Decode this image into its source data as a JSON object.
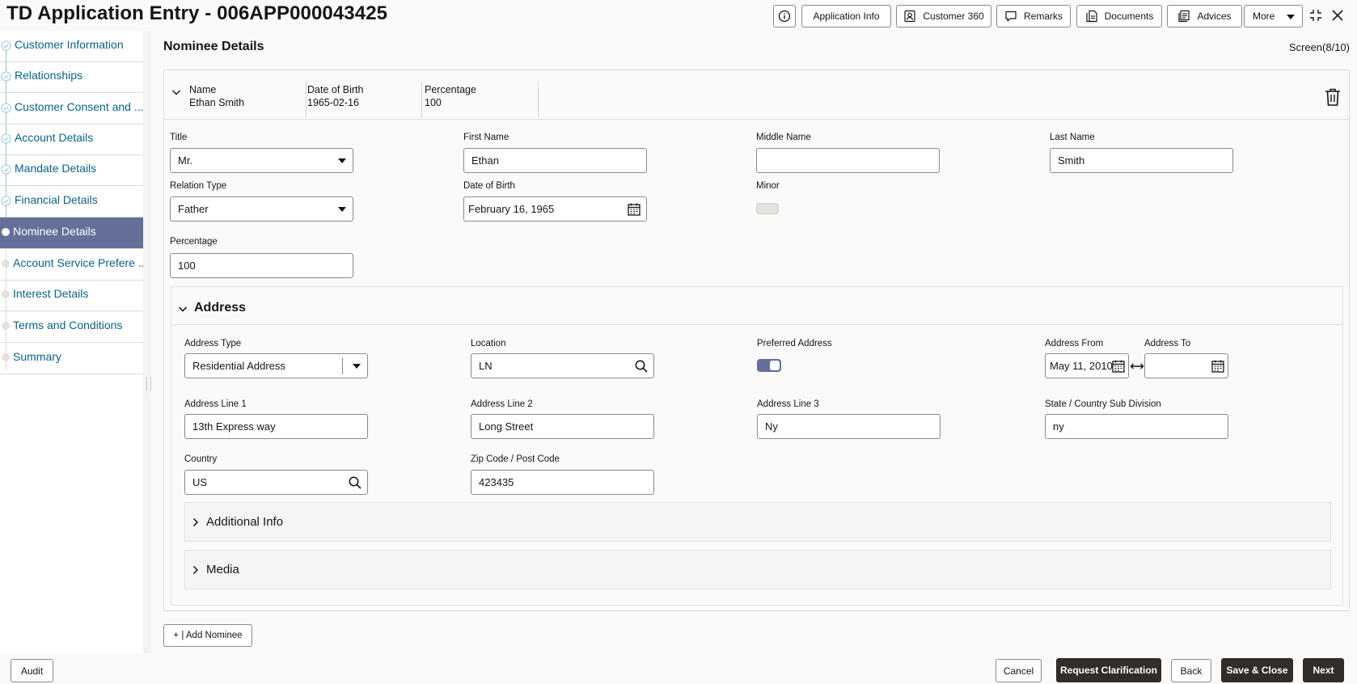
{
  "header": {
    "title": "TD Application Entry - 006APP000043425",
    "buttons": {
      "application_info": "Application Info",
      "customer_360": "Customer 360",
      "remarks": "Remarks",
      "documents": "Documents",
      "advices": "Advices",
      "more": "More"
    }
  },
  "sidebar": {
    "items": [
      {
        "label": "Customer Information",
        "state": "completed"
      },
      {
        "label": "Relationships",
        "state": "completed"
      },
      {
        "label": "Customer Consent and ...",
        "state": "completed"
      },
      {
        "label": "Account Details",
        "state": "completed"
      },
      {
        "label": "Mandate Details",
        "state": "completed"
      },
      {
        "label": "Financial Details",
        "state": "completed"
      },
      {
        "label": "Nominee Details",
        "state": "active"
      },
      {
        "label": "Account Service Prefere ...",
        "state": "pending"
      },
      {
        "label": "Interest Details",
        "state": "pending"
      },
      {
        "label": "Terms and Conditions",
        "state": "pending"
      },
      {
        "label": "Summary",
        "state": "pending"
      }
    ]
  },
  "main": {
    "section_title": "Nominee Details",
    "screen": "Screen(8/10)",
    "nominee_summary": {
      "name_label": "Name",
      "name_value": "Ethan Smith",
      "dob_label": "Date of Birth",
      "dob_value": "1965-02-16",
      "pct_label": "Percentage",
      "pct_value": "100"
    },
    "fields": {
      "title_label": "Title",
      "title_value": "Mr.",
      "first_name_label": "First Name",
      "first_name_value": "Ethan",
      "middle_name_label": "Middle Name",
      "middle_name_value": "",
      "last_name_label": "Last Name",
      "last_name_value": "Smith",
      "relation_type_label": "Relation Type",
      "relation_type_value": "Father",
      "dob_label": "Date of Birth",
      "dob_value": "February 16, 1965",
      "minor_label": "Minor",
      "minor_on": false,
      "percentage_label": "Percentage",
      "percentage_value": "100"
    },
    "address": {
      "title": "Address",
      "address_type_label": "Address Type",
      "address_type_value": "Residential Address",
      "location_label": "Location",
      "location_value": "LN",
      "preferred_label": "Preferred Address",
      "preferred_on": true,
      "address_from_label": "Address From",
      "address_from_value": "May 11, 2010",
      "address_to_label": "Address To",
      "address_to_value": "",
      "line1_label": "Address Line 1",
      "line1_value": "13th Express way",
      "line2_label": "Address Line 2",
      "line2_value": "Long Street",
      "line3_label": "Address Line 3",
      "line3_value": "Ny",
      "state_label": "State / Country Sub Division",
      "state_value": "ny",
      "country_label": "Country",
      "country_value": "US",
      "zip_label": "Zip Code / Post Code",
      "zip_value": "423435",
      "additional_info": "Additional Info",
      "media": "Media"
    },
    "add_nominee": "+ | Add Nominee"
  },
  "footer": {
    "audit": "Audit",
    "cancel": "Cancel",
    "request_clarification": "Request Clarification",
    "back": "Back",
    "save_close": "Save & Close",
    "next": "Next"
  },
  "colors": {
    "accent": "#64709a",
    "link": "#0d6185",
    "dark_button": "#312d2a",
    "background": "#fbfaf8"
  }
}
